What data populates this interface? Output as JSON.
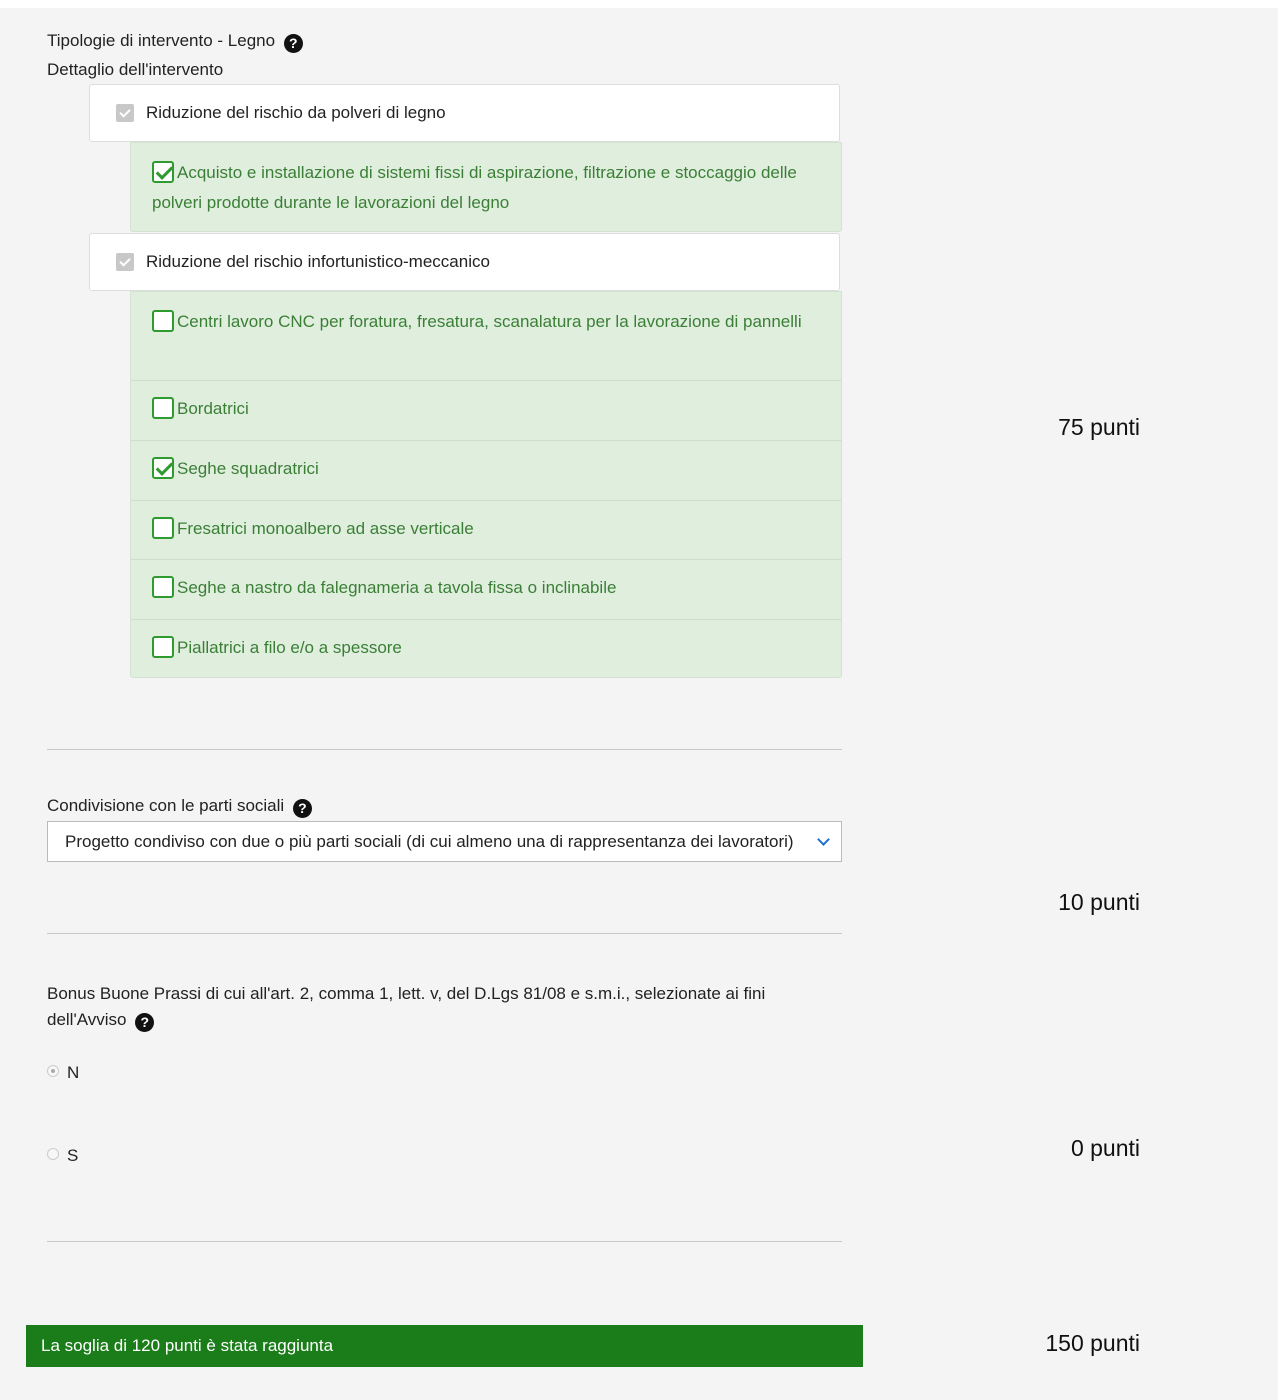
{
  "tipologie": {
    "title": "Tipologie di intervento - Legno",
    "subtitle": "Dettaglio dell'intervento",
    "help_icon": "question-circle-icon",
    "groups": [
      {
        "label": "Riduzione del rischio da polveri di legno",
        "checked": true,
        "items": [
          {
            "label": "Acquisto e installazione di sistemi fissi di aspirazione, filtrazione e stoccaggio delle polveri prodotte durante le lavorazioni del legno",
            "checked": true
          }
        ]
      },
      {
        "label": "Riduzione del rischio infortunistico-meccanico",
        "checked": true,
        "items": [
          {
            "label": "Centri lavoro CNC per foratura, fresatura, scanalatura per la lavorazione di pannelli",
            "checked": false
          },
          {
            "label": "Bordatrici",
            "checked": false
          },
          {
            "label": "Seghe squadratrici",
            "checked": true
          },
          {
            "label": "Fresatrici monoalbero ad asse verticale",
            "checked": false
          },
          {
            "label": "Seghe a nastro da falegnameria a tavola fissa o inclinabile",
            "checked": false
          },
          {
            "label": "Piallatrici a filo e/o a spessore",
            "checked": false
          }
        ]
      }
    ],
    "points": "75 punti"
  },
  "condivisione": {
    "label": "Condivisione con le parti sociali",
    "selected": "Progetto condiviso con due o più parti sociali (di cui almeno una di rappresentanza dei lavoratori)",
    "points": "10 punti"
  },
  "bonus": {
    "label": "Bonus Buone Prassi di cui all'art. 2, comma 1, lett. v, del D.Lgs 81/08 e s.m.i., selezionate ai fini dell'Avviso",
    "options": [
      {
        "label": "N",
        "selected": true
      },
      {
        "label": "S",
        "selected": false
      }
    ],
    "points": "0 punti"
  },
  "summary": {
    "message": "La soglia di 120 punti è stata raggiunta",
    "total": "150 punti",
    "accent": "#1a7d1a"
  }
}
